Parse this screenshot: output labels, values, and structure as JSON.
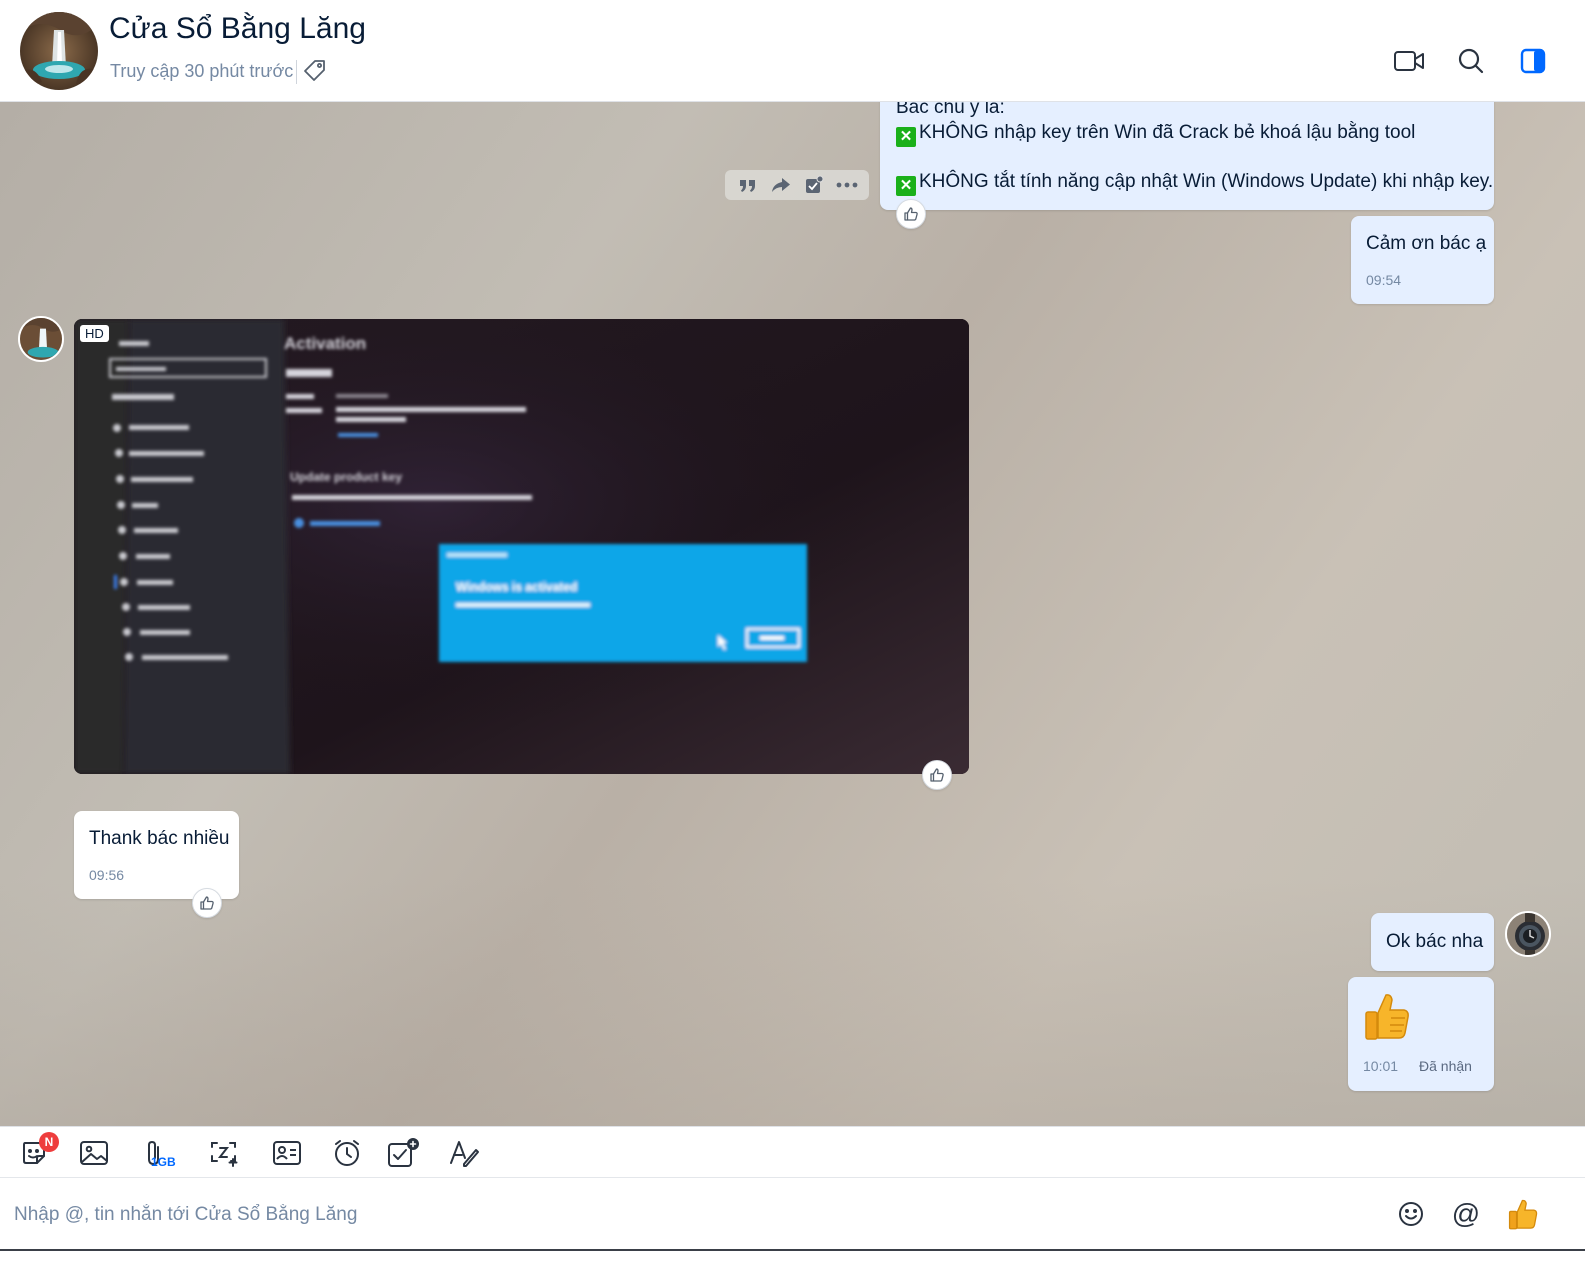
{
  "header": {
    "title": "Cửa Sổ Bằng Lăng",
    "status": "Truy cập 30 phút trước"
  },
  "messages": {
    "first": {
      "line1": "Bác chú ý là:",
      "line2": "KHÔNG nhập key trên Win đã Crack bẻ khoá lậu bằng tool",
      "line3": "KHÔNG tắt tính năng cập nhật Win (Windows Update) khi nhập key."
    },
    "thanks_out": {
      "text": "Cảm ơn bác ạ",
      "time": "09:54"
    },
    "image": {
      "badge": "HD",
      "screen_heading": "Activation",
      "dialog_title": "Windows is activated",
      "section_title": "Update product key"
    },
    "thanks_in": {
      "text": "Thank bác nhiều",
      "time": "09:56"
    },
    "ok_out": {
      "text": "Ok bác nha"
    },
    "sticker_out": {
      "emoji": "👍",
      "time": "10:01",
      "status": "Đã nhận"
    }
  },
  "toolbar": {
    "sticker_badge": "N",
    "file_limit": "1GB"
  },
  "composer": {
    "placeholder": "Nhập @, tin nhắn tới Cửa Sổ Bằng Lăng",
    "mention": "@",
    "quick_like": "👍"
  },
  "icons": [
    "video-call-icon",
    "search-icon",
    "sidebar-toggle-icon",
    "tag-icon",
    "quote-icon",
    "forward-icon",
    "task-icon",
    "more-icon",
    "like-icon",
    "sticker-icon",
    "image-icon",
    "attach-icon",
    "screenshot-icon",
    "contact-card-icon",
    "reminder-icon",
    "todo-icon",
    "format-text-icon",
    "emoji-icon"
  ],
  "colors": {
    "accent": "#0068ff",
    "bubble_out": "#e5efff",
    "bubble_in": "#ffffff",
    "badge": "#ee3d3d"
  }
}
